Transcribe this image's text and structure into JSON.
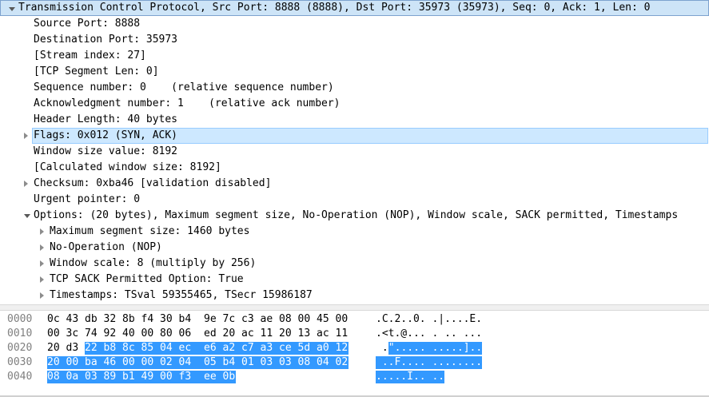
{
  "tree": [
    {
      "text": "Transmission Control Protocol, Src Port: 8888 (8888), Dst Port: 35973 (35973), Seq: 0, Ack: 1, Len: 0",
      "indent": 0,
      "expander": "open",
      "style": "header"
    },
    {
      "text": "Source Port: 8888",
      "indent": 1,
      "expander": "none"
    },
    {
      "text": "Destination Port: 35973",
      "indent": 1,
      "expander": "none"
    },
    {
      "text": "[Stream index: 27]",
      "indent": 1,
      "expander": "none"
    },
    {
      "text": "[TCP Segment Len: 0]",
      "indent": 1,
      "expander": "none"
    },
    {
      "text": "Sequence number: 0    (relative sequence number)",
      "indent": 1,
      "expander": "none"
    },
    {
      "text": "Acknowledgment number: 1    (relative ack number)",
      "indent": 1,
      "expander": "none"
    },
    {
      "text": "Header Length: 40 bytes",
      "indent": 1,
      "expander": "none"
    },
    {
      "text": "Flags: 0x012 (SYN, ACK)",
      "indent": 1,
      "expander": "closed",
      "style": "sel"
    },
    {
      "text": "Window size value: 8192",
      "indent": 1,
      "expander": "none"
    },
    {
      "text": "[Calculated window size: 8192]",
      "indent": 1,
      "expander": "none"
    },
    {
      "text": "Checksum: 0xba46 [validation disabled]",
      "indent": 1,
      "expander": "closed"
    },
    {
      "text": "Urgent pointer: 0",
      "indent": 1,
      "expander": "none"
    },
    {
      "text": "Options: (20 bytes), Maximum segment size, No-Operation (NOP), Window scale, SACK permitted, Timestamps",
      "indent": 1,
      "expander": "open"
    },
    {
      "text": "Maximum segment size: 1460 bytes",
      "indent": 2,
      "expander": "closed"
    },
    {
      "text": "No-Operation (NOP)",
      "indent": 2,
      "expander": "closed"
    },
    {
      "text": "Window scale: 8 (multiply by 256)",
      "indent": 2,
      "expander": "closed"
    },
    {
      "text": "TCP SACK Permitted Option: True",
      "indent": 2,
      "expander": "closed"
    },
    {
      "text": "Timestamps: TSval 59355465, TSecr 15986187",
      "indent": 2,
      "expander": "closed"
    }
  ],
  "hex": [
    {
      "offset": "0000",
      "bytes": [
        "0c",
        "43",
        "db",
        "32",
        "8b",
        "f4",
        "30",
        "b4",
        "9e",
        "7c",
        "c3",
        "ae",
        "08",
        "00",
        "45",
        "00"
      ],
      "ascii": ".C.2..0. .|....E.",
      "hi_start": 16
    },
    {
      "offset": "0010",
      "bytes": [
        "00",
        "3c",
        "74",
        "92",
        "40",
        "00",
        "80",
        "06",
        "ed",
        "20",
        "ac",
        "11",
        "20",
        "13",
        "ac",
        "11"
      ],
      "ascii": ".<t.@... . .. ...",
      "hi_start": 16
    },
    {
      "offset": "0020",
      "bytes": [
        "20",
        "d3",
        "22",
        "b8",
        "8c",
        "85",
        "04",
        "ec",
        "e6",
        "a2",
        "c7",
        "a3",
        "ce",
        "5d",
        "a0",
        "12"
      ],
      "ascii": " .\"..... .....]..",
      "hi_start": 2
    },
    {
      "offset": "0030",
      "bytes": [
        "20",
        "00",
        "ba",
        "46",
        "00",
        "00",
        "02",
        "04",
        "05",
        "b4",
        "01",
        "03",
        "03",
        "08",
        "04",
        "02"
      ],
      "ascii": " ..F.... ........",
      "hi_start": 0
    },
    {
      "offset": "0040",
      "bytes": [
        "08",
        "0a",
        "03",
        "89",
        "b1",
        "49",
        "00",
        "f3",
        "ee",
        "0b"
      ],
      "ascii": ".....I.. ..",
      "hi_start": 0
    }
  ]
}
